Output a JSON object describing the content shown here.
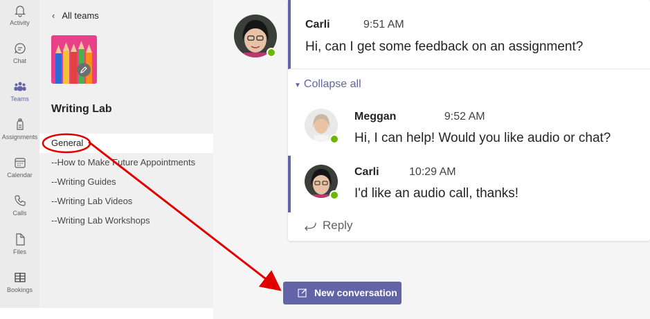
{
  "rail": {
    "items": [
      {
        "label": "Activity",
        "icon": "bell-icon"
      },
      {
        "label": "Chat",
        "icon": "chat-icon"
      },
      {
        "label": "Teams",
        "icon": "teams-icon",
        "active": true
      },
      {
        "label": "Assignments",
        "icon": "assignments-icon"
      },
      {
        "label": "Calendar",
        "icon": "calendar-icon"
      },
      {
        "label": "Calls",
        "icon": "phone-icon"
      },
      {
        "label": "Files",
        "icon": "file-icon"
      },
      {
        "label": "Bookings",
        "icon": "bookings-icon"
      }
    ]
  },
  "panel": {
    "back_label": "All teams",
    "team_name": "Writing Lab",
    "channels": [
      {
        "label": "General",
        "selected": true
      },
      {
        "label": "--How to Make Future Appointments"
      },
      {
        "label": "--Writing Guides"
      },
      {
        "label": "--Writing Lab Videos"
      },
      {
        "label": "--Writing Lab Workshops"
      }
    ]
  },
  "thread": {
    "root": {
      "author": "Carli",
      "time": "9:51 AM",
      "text": "Hi, can I get some feedback on an assignment?"
    },
    "collapse_label": "Collapse all",
    "replies": [
      {
        "author": "Meggan",
        "time": "9:52 AM",
        "text": "Hi, I can help! Would you like audio or chat?"
      },
      {
        "author": "Carli",
        "time": "10:29 AM",
        "text": "I'd like an audio call, thanks!"
      }
    ],
    "reply_label": "Reply"
  },
  "new_conversation_label": "New conversation",
  "colors": {
    "accent": "#6264a7",
    "presence": "#6bb700",
    "annotation": "#e00000"
  }
}
